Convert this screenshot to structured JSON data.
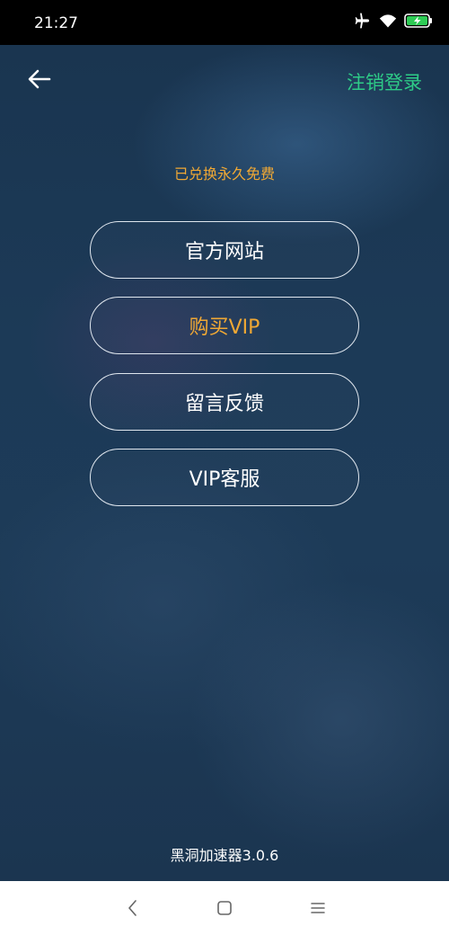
{
  "status_bar": {
    "time": "21:27",
    "icons": [
      "airplane-icon",
      "wifi-icon",
      "battery-charging-icon"
    ],
    "battery_color": "#2ecb55"
  },
  "header": {
    "back_icon": "arrow-left-icon",
    "logout_label": "注销登录",
    "logout_color": "#2ecb87"
  },
  "vip_status": "已兑换永久免费",
  "menu": {
    "official_site": "官方网站",
    "buy_vip": "购买VIP",
    "feedback": "留言反馈",
    "vip_support": "VIP客服"
  },
  "accent_color": "#f0a834",
  "footer": {
    "version": "黑洞加速器3.0.6"
  },
  "nav_bar": {
    "icons": [
      "back-icon",
      "home-icon",
      "menu-icon"
    ]
  }
}
